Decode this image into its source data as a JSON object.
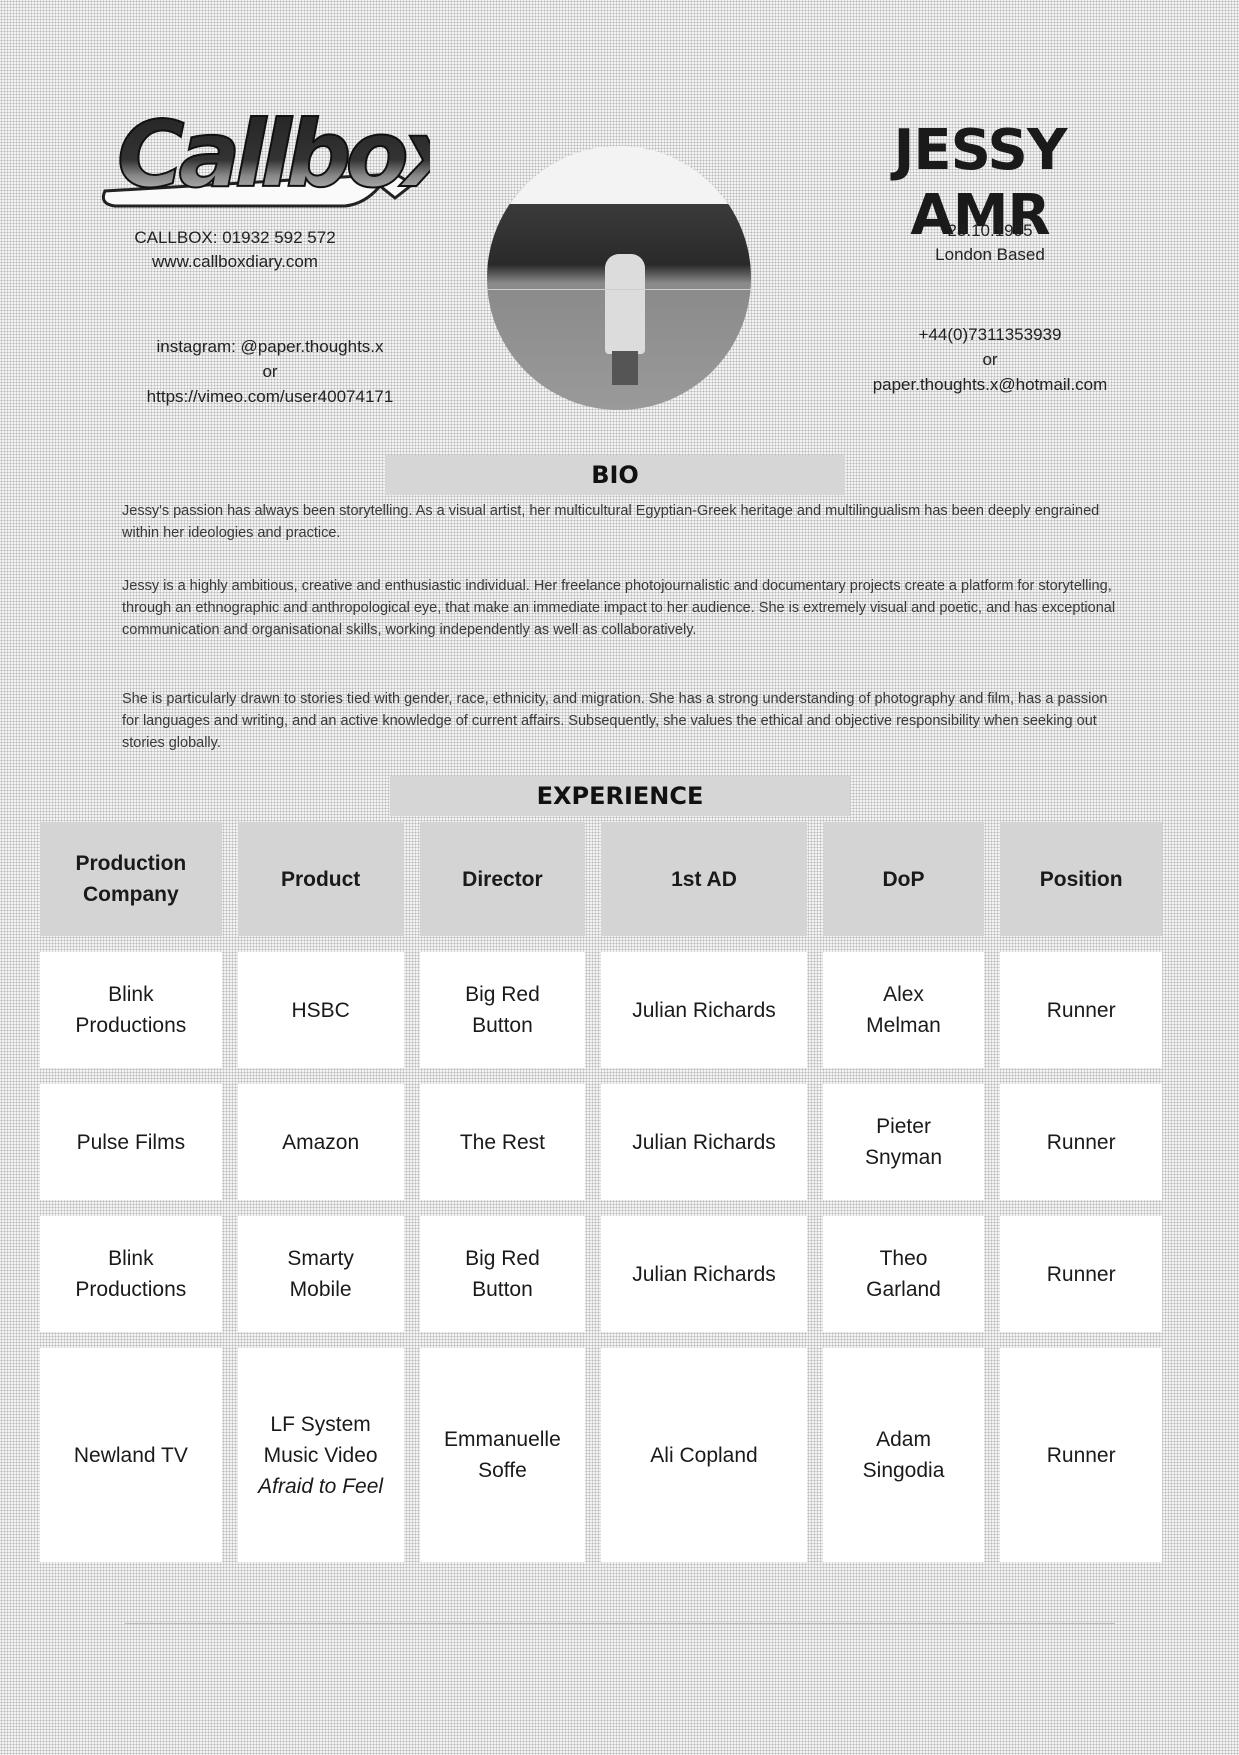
{
  "agency": {
    "logo_text": "Callbox",
    "phone_line": "CALLBOX: 01932 592 572",
    "website": "www.callboxdiary.com"
  },
  "profile": {
    "name": "JESSY AMR",
    "dob": "23.10.1995",
    "location": "London Based",
    "photo": "portrait-photo"
  },
  "socials": {
    "instagram": "instagram: @paper.thoughts.x",
    "or": "or",
    "vimeo": "https://vimeo.com/user40074171"
  },
  "contact": {
    "phone": "+44(0)7311353939",
    "or": "or",
    "email": "paper.thoughts.x@hotmail.com"
  },
  "bio": {
    "heading": "BIO",
    "paragraphs": [
      "Jessy's passion has always been storytelling. As a visual artist, her multicultural Egyptian-Greek heritage and multilingualism has been deeply engrained within her ideologies and practice.",
      "Jessy is a highly ambitious, creative and enthusiastic individual. Her freelance photojournalistic and documentary projects create a platform for storytelling, through an ethnographic and anthropological eye, that make an immediate impact to her audience. She is extremely visual and poetic, and has exceptional communication and organisational skills, working independently as well as collaboratively.",
      "She is particularly drawn to stories tied with gender, race, ethnicity, and migration. She has a strong understanding of photography and film, has a passion for languages and writing, and an active knowledge of current affairs. Subsequently, she values the ethical and objective responsibility when seeking out stories globally."
    ]
  },
  "experience": {
    "heading": "EXPERIENCE",
    "columns": [
      "Production Company",
      "Product",
      "Director",
      "1st AD",
      "DoP",
      "Position"
    ],
    "rows": [
      {
        "company": "Blink Productions",
        "product": "HSBC",
        "product_italic": "",
        "director": "Big Red Button",
        "first_ad": "Julian Richards",
        "dop": "Alex Melman",
        "position": "Runner"
      },
      {
        "company": "Pulse Films",
        "product": "Amazon",
        "product_italic": "",
        "director": "The Rest",
        "first_ad": "Julian Richards",
        "dop": "Pieter Snyman",
        "position": "Runner"
      },
      {
        "company": "Blink Productions",
        "product": "Smarty Mobile",
        "product_italic": "",
        "director": "Big Red Button",
        "first_ad": "Julian Richards",
        "dop": "Theo Garland",
        "position": "Runner"
      },
      {
        "company": "Newland TV",
        "product": "LF System Music Video",
        "product_italic": "Afraid to Feel",
        "director": "Emmanuelle Soffe",
        "first_ad": "Ali Copland",
        "dop": "Adam Singodia",
        "position": "Runner"
      }
    ]
  }
}
